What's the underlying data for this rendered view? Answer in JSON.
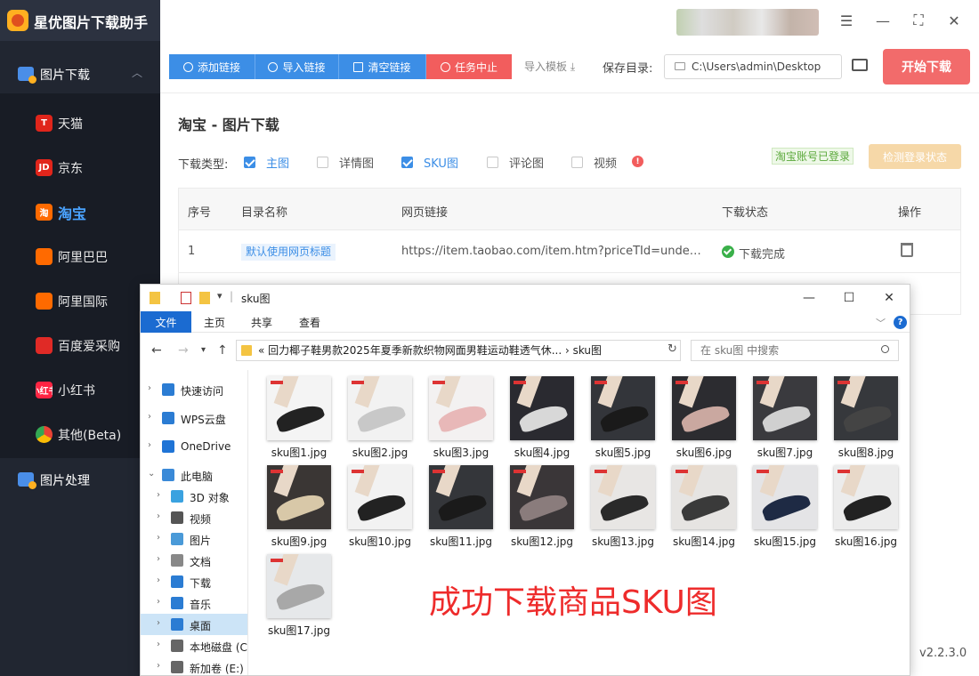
{
  "app": {
    "title": "星优图片下载助手",
    "version": "v2.2.3.0"
  },
  "sidebar": {
    "group_download": "图片下载",
    "group_process": "图片处理",
    "items": [
      {
        "label": "天猫",
        "icon": "tmall-icon",
        "badge": "T",
        "color": "#e0251b"
      },
      {
        "label": "京东",
        "icon": "jd-icon",
        "badge": "JD",
        "color": "#e1251b"
      },
      {
        "label": "淘宝",
        "icon": "taobao-icon",
        "badge": "淘",
        "color": "#ff6a00"
      },
      {
        "label": "阿里巴巴",
        "icon": "alibaba-icon",
        "badge": "",
        "color": "#ff6a00"
      },
      {
        "label": "阿里国际",
        "icon": "alibaba-intl-icon",
        "badge": "",
        "color": "#ff6a00"
      },
      {
        "label": "百度爱采购",
        "icon": "baidu-icon",
        "badge": "",
        "color": "#e02a26"
      },
      {
        "label": "小红书",
        "icon": "xiaohongshu-icon",
        "badge": "小红书",
        "color": "#ff2442"
      },
      {
        "label": "其他(Beta)",
        "icon": "chrome-icon",
        "badge": "",
        "color": "#4285f4"
      }
    ],
    "active": "淘宝"
  },
  "toolbar": {
    "add_link": "添加链接",
    "import_link": "导入链接",
    "clear_link": "清空链接",
    "stop_task": "任务中止",
    "import_template": "导入模板",
    "save_dir_label": "保存目录:",
    "save_dir_value": "C:\\Users\\admin\\Desktop",
    "start_download": "开始下载"
  },
  "content": {
    "page_title": "淘宝 - 图片下载",
    "download_type_label": "下载类型:",
    "options": [
      {
        "label": "主图",
        "checked": true
      },
      {
        "label": "详情图",
        "checked": false
      },
      {
        "label": "SKU图",
        "checked": true
      },
      {
        "label": "评论图",
        "checked": false
      },
      {
        "label": "视频",
        "checked": false
      }
    ],
    "login_status": "淘宝账号已登录",
    "check_login": "检测登录状态",
    "table": {
      "headers": [
        "序号",
        "目录名称",
        "网页链接",
        "下载状态",
        "操作"
      ],
      "rows": [
        {
          "index": "1",
          "dir_name": "默认使用网页标题",
          "url": "https://item.taobao.com/item.htm?priceTId=undefin...",
          "status": "下载完成"
        }
      ]
    }
  },
  "explorer": {
    "title": "sku图",
    "ribbon_tabs": [
      "文件",
      "主页",
      "共享",
      "查看"
    ],
    "address": "« 回力椰子鞋男款2025年夏季新款织物网面男鞋运动鞋透气休...  ›  sku图",
    "search_placeholder": "在 sku图 中搜索",
    "nav": [
      {
        "label": "快速访问",
        "icon": "star-icon",
        "color": "#2b7cd3"
      },
      {
        "label": "WPS云盘",
        "icon": "cloud-icon",
        "color": "#2b7cd3"
      },
      {
        "label": "OneDrive",
        "icon": "onedrive-icon",
        "color": "#1f74d6"
      },
      {
        "label": "此电脑",
        "icon": "pc-icon",
        "color": "#3a8ad8"
      },
      {
        "label": "3D 对象",
        "icon": "cube-icon",
        "color": "#3aa2e0"
      },
      {
        "label": "视频",
        "icon": "video-icon",
        "color": "#555"
      },
      {
        "label": "图片",
        "icon": "picture-icon",
        "color": "#4a9ad8"
      },
      {
        "label": "文档",
        "icon": "document-icon",
        "color": "#888"
      },
      {
        "label": "下载",
        "icon": "download-icon",
        "color": "#2b7cd3"
      },
      {
        "label": "音乐",
        "icon": "music-icon",
        "color": "#2b7cd3"
      },
      {
        "label": "桌面",
        "icon": "desktop-icon",
        "color": "#2b7cd3"
      },
      {
        "label": "本地磁盘 (C",
        "icon": "disk-icon",
        "color": "#666"
      },
      {
        "label": "新加卷 (E:)",
        "icon": "disk-icon",
        "color": "#666"
      }
    ],
    "files": [
      {
        "name": "sku图1.jpg",
        "bg": "#f4f4f4",
        "shoe": "#222"
      },
      {
        "name": "sku图2.jpg",
        "bg": "#f2f2f2",
        "shoe": "#c8c8c8"
      },
      {
        "name": "sku图3.jpg",
        "bg": "#f3f1f1",
        "shoe": "#e8b8b8"
      },
      {
        "name": "sku图4.jpg",
        "bg": "#2a2a30",
        "shoe": "#d8d8d8"
      },
      {
        "name": "sku图5.jpg",
        "bg": "#33353a",
        "shoe": "#1a1a1a"
      },
      {
        "name": "sku图6.jpg",
        "bg": "#2c2c30",
        "shoe": "#caa8a0"
      },
      {
        "name": "sku图7.jpg",
        "bg": "#3a3a3e",
        "shoe": "#d0d0d0"
      },
      {
        "name": "sku图8.jpg",
        "bg": "#36383c",
        "shoe": "#444"
      },
      {
        "name": "sku图9.jpg",
        "bg": "#3a3634",
        "shoe": "#d8c8a8"
      },
      {
        "name": "sku图10.jpg",
        "bg": "#f2f2f2",
        "shoe": "#222"
      },
      {
        "name": "sku图11.jpg",
        "bg": "#34363a",
        "shoe": "#1a1a1a"
      },
      {
        "name": "sku图12.jpg",
        "bg": "#3a3638",
        "shoe": "#8a7c7c"
      },
      {
        "name": "sku图13.jpg",
        "bg": "#e8e6e4",
        "shoe": "#2a2a2a"
      },
      {
        "name": "sku图14.jpg",
        "bg": "#e6e4e2",
        "shoe": "#3a3a3a"
      },
      {
        "name": "sku图15.jpg",
        "bg": "#e4e4e6",
        "shoe": "#1e2a44"
      },
      {
        "name": "sku图16.jpg",
        "bg": "#ececec",
        "shoe": "#222"
      },
      {
        "name": "sku图17.jpg",
        "bg": "#e6e8ea",
        "shoe": "#a8a8a8"
      }
    ]
  },
  "annotation": "成功下载商品SKU图",
  "colors": {
    "accent_blue": "#3c8ee6",
    "danger_red": "#f25d5d",
    "start_button": "#f26b6b",
    "sidebar_bg": "#212631",
    "success_green": "#3ab04a"
  }
}
